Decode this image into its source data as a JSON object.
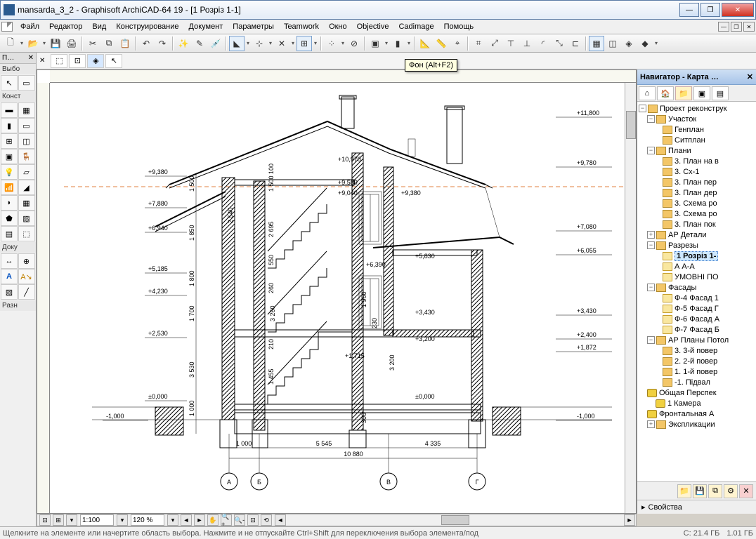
{
  "window": {
    "title": "mansarda_3_2 - Graphisoft ArchiCAD-64 19 - [1 Розріз 1-1]",
    "min": "—",
    "max": "❐",
    "close": "✕"
  },
  "menu": {
    "items": [
      "Файл",
      "Редактор",
      "Вид",
      "Конструирование",
      "Документ",
      "Параметры",
      "Teamwork",
      "Окно",
      "Objective",
      "Cadimage",
      "Помощь"
    ]
  },
  "tooltip": "Фон (Alt+F2)",
  "toolbox": {
    "head1": "П…",
    "head2": "Выбо",
    "labels": {
      "construct": "Конст",
      "doc": "Доку",
      "misc": "Разн"
    }
  },
  "navigator": {
    "title": "Навигатор - Карта …",
    "project": "Проект реконструк",
    "uchastok": "Участок",
    "genplan": "Генплан",
    "sitplan": "Ситплан",
    "plany": "Плани",
    "plan3": "3. План на в",
    "plan3cx": "3. Сх-1",
    "plan3per": "3. План пер",
    "plan3der": "3. План дер",
    "schema3": "3. Схема ро",
    "schema3b": "3. Схема ро",
    "plan3pok": "3. План пок",
    "ardetali": "АР Детали",
    "razrezy": "Разрезы",
    "rozriz11": "1 Розріз 1-",
    "aa": "А А-А",
    "umovni": "УМОВНІ ПО",
    "fasady": "Фасады",
    "f4": "Ф-4 Фасад 1",
    "f5": "Ф-5 Фасад Г",
    "f6": "Ф-6 Фасад А",
    "f7": "Ф-7 Фасад Б",
    "arplany": "АР Планы Потол",
    "et3": "3. 3-й повер",
    "et2": "2. 2-й повер",
    "et1": "1. 1-й повер",
    "podval": "-1. Підвал",
    "perspek": "Общая Перспек",
    "kamera": "1 Камера",
    "front": "Фронтальная А",
    "ekspl": "Экспликации",
    "props_label": "Свойства"
  },
  "zoom": {
    "scale": "1:100",
    "pct": "120 %"
  },
  "status": {
    "hint": "Щелкните на элементе или начертите область выбора. Нажмите и не отпускайте Ctrl+Shift для переключения выбора элемента/под",
    "c": "C: 21.4 ГБ",
    "m": "1.01 ГБ"
  },
  "elevations": {
    "l1": "+9,380",
    "l2": "+7,880",
    "l3": "+6,940",
    "l4": "+5,185",
    "l5": "+4,230",
    "l6": "+2,530",
    "l7": "±0,000",
    "l8": "-1,000",
    "r1": "+11,800",
    "r2": "+9,780",
    "r3": "+9,380",
    "r4": "+7,080",
    "r5": "+6,055",
    "r6": "+5,830",
    "r7": "+3,430",
    "r8": "+2,400",
    "r9": "+1,872",
    "r10": "±0,000",
    "r11": "-1,000",
    "c1": "+10,970",
    "c2": "+9,580",
    "c3": "+9,040",
    "c4": "+6,390",
    "c5": "+1,715",
    "c6": "+3,430",
    "c7": "+3,200"
  },
  "dims": {
    "h1": "1 500",
    "h2": "1 850",
    "h3": "1 800",
    "h4": "1 700",
    "h5": "3 530",
    "h6": "1 000",
    "v1": "1 500",
    "v2": "100",
    "v3": "2 540",
    "v4": "2 695",
    "v5": "550",
    "v6": "260",
    "v7": "1 960",
    "v8": "210",
    "v9": "1 455",
    "v10": "3 260",
    "v11": "230",
    "v12": "300",
    "v13": "3 200",
    "b1": "1 000",
    "b2": "5 545",
    "b3": "4 335",
    "b4": "10 880"
  },
  "axes": {
    "a": "А",
    "b": "Б",
    "v": "В",
    "g": "Г"
  }
}
